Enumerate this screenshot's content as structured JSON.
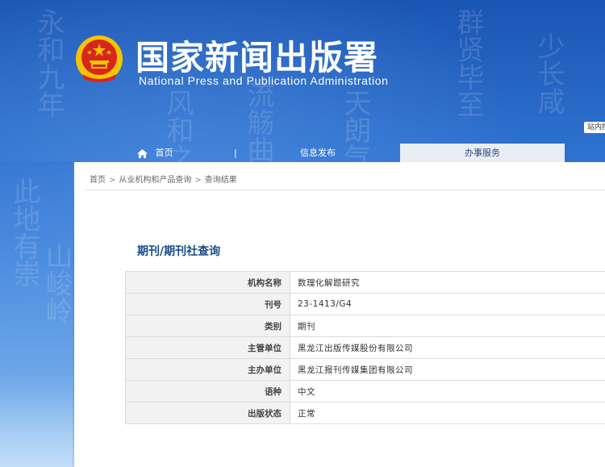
{
  "header": {
    "title": "国家新闻出版署",
    "subtitle": "National Press and Publication Administration",
    "search_button": "站内搜索"
  },
  "nav": {
    "home": "首页",
    "separator": "|",
    "info": "信息发布",
    "service": "办事服务"
  },
  "breadcrumb": [
    "首页",
    "从业机构和产品查询",
    "查询结果"
  ],
  "breadcrumb_sep": ">",
  "page_title": "期刊/期刊社查询",
  "rows": [
    {
      "label": "机构名称",
      "value": "数理化解题研究"
    },
    {
      "label": "刊号",
      "value": "23-1413/G4"
    },
    {
      "label": "类别",
      "value": "期刊"
    },
    {
      "label": "主管单位",
      "value": "黑龙江出版传媒股份有限公司"
    },
    {
      "label": "主办单位",
      "value": "黑龙江报刊传媒集团有限公司"
    },
    {
      "label": "语种",
      "value": "中文"
    },
    {
      "label": "出版状态",
      "value": "正常"
    }
  ],
  "colors": {
    "header_blue": "#1d5cb8",
    "title_blue": "#1a4c8a",
    "emblem_red": "#d7261e",
    "emblem_gold": "#f5c400"
  }
}
